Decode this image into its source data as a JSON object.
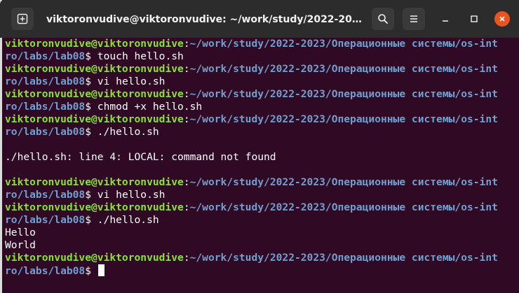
{
  "window": {
    "title": "viktoronvudive@viktoronvudive: ~/work/study/2022-2023/Опе...",
    "controls": {
      "new_tab_icon": "new-tab-icon",
      "search_icon": "search-icon",
      "menu_icon": "hamburger-menu-icon",
      "minimize_icon": "minimize-icon",
      "maximize_icon": "maximize-icon",
      "close_icon": "close-icon"
    }
  },
  "colors": {
    "terminal_bg": "#300a24",
    "user": "#8ae234",
    "path": "#729fcf",
    "text": "#ffffff",
    "titlebar": "#2c2c2c",
    "close": "#e95420"
  },
  "terminal": {
    "lines": [
      {
        "user": "viktoronvudive@viktoronvudive",
        "sep": ":",
        "path": "~/work/study/2022-2023/Операционные системы/os-int",
        "cmd": ""
      },
      {
        "user": "",
        "sep": "",
        "path": "ro/labs/lab08",
        "cmd": "$ touch hello.sh"
      },
      {
        "user": "viktoronvudive@viktoronvudive",
        "sep": ":",
        "path": "~/work/study/2022-2023/Операционные системы/os-int",
        "cmd": ""
      },
      {
        "user": "",
        "sep": "",
        "path": "ro/labs/lab08",
        "cmd": "$ vi hello.sh"
      },
      {
        "user": "viktoronvudive@viktoronvudive",
        "sep": ":",
        "path": "~/work/study/2022-2023/Операционные системы/os-int",
        "cmd": ""
      },
      {
        "user": "",
        "sep": "",
        "path": "ro/labs/lab08",
        "cmd": "$ chmod +x hello.sh"
      },
      {
        "user": "viktoronvudive@viktoronvudive",
        "sep": ":",
        "path": "~/work/study/2022-2023/Операционные системы/os-int",
        "cmd": ""
      },
      {
        "user": "",
        "sep": "",
        "path": "ro/labs/lab08",
        "cmd": "$ ./hello.sh"
      },
      {
        "user": "",
        "sep": "",
        "path": "",
        "cmd": ""
      },
      {
        "user": "",
        "sep": "",
        "path": "",
        "cmd": "./hello.sh: line 4: LOCAL: command not found"
      },
      {
        "user": "",
        "sep": "",
        "path": "",
        "cmd": ""
      },
      {
        "user": "viktoronvudive@viktoronvudive",
        "sep": ":",
        "path": "~/work/study/2022-2023/Операционные системы/os-int",
        "cmd": ""
      },
      {
        "user": "",
        "sep": "",
        "path": "ro/labs/lab08",
        "cmd": "$ vi hello.sh"
      },
      {
        "user": "viktoronvudive@viktoronvudive",
        "sep": ":",
        "path": "~/work/study/2022-2023/Операционные системы/os-int",
        "cmd": ""
      },
      {
        "user": "",
        "sep": "",
        "path": "ro/labs/lab08",
        "cmd": "$ ./hello.sh"
      },
      {
        "user": "",
        "sep": "",
        "path": "",
        "cmd": "Hello"
      },
      {
        "user": "",
        "sep": "",
        "path": "",
        "cmd": "World"
      },
      {
        "user": "viktoronvudive@viktoronvudive",
        "sep": ":",
        "path": "~/work/study/2022-2023/Операционные системы/os-int",
        "cmd": ""
      },
      {
        "user": "",
        "sep": "",
        "path": "ro/labs/lab08",
        "cmd": "$ "
      }
    ]
  }
}
